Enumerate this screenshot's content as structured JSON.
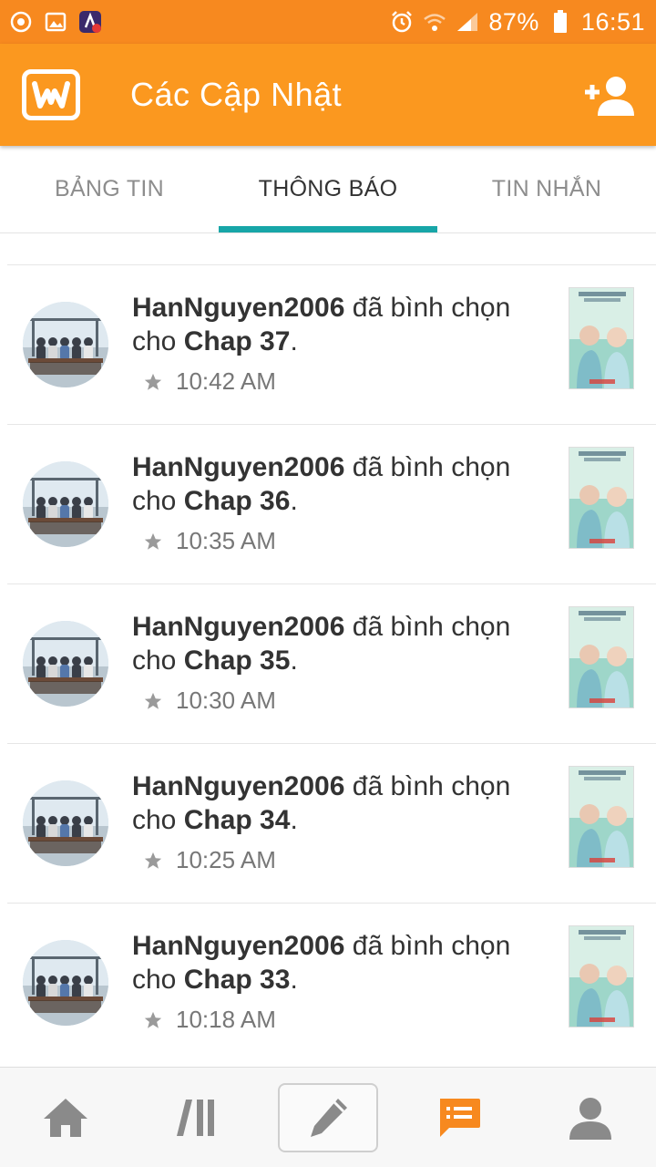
{
  "status_bar": {
    "left_icons": [
      "compass-icon",
      "image-icon",
      "app-alert-icon"
    ],
    "right_icons": [
      "alarm-icon",
      "wifi-icon",
      "signal-icon",
      "battery-icon"
    ],
    "battery": "87%",
    "time": "16:51"
  },
  "app_bar": {
    "title": "Các Cập Nhật",
    "color": "#fb981f"
  },
  "tabs": [
    {
      "label": "BẢNG TIN",
      "active": false
    },
    {
      "label": "THÔNG BÁO",
      "active": true
    },
    {
      "label": "TIN NHẮN",
      "active": false
    }
  ],
  "notifications": [
    {
      "user": "HanNguyen2006",
      "action": " đã bình chọn",
      "prefix": "cho ",
      "chapter": "Chap 37",
      "suffix": ".",
      "time": "10:42 AM"
    },
    {
      "user": "HanNguyen2006",
      "action": " đã bình chọn",
      "prefix": "cho ",
      "chapter": "Chap 36",
      "suffix": ".",
      "time": "10:35 AM"
    },
    {
      "user": "HanNguyen2006",
      "action": " đã bình chọn",
      "prefix": "cho ",
      "chapter": "Chap 35",
      "suffix": ".",
      "time": "10:30 AM"
    },
    {
      "user": "HanNguyen2006",
      "action": " đã bình chọn",
      "prefix": "cho ",
      "chapter": "Chap 34",
      "suffix": ".",
      "time": "10:25 AM"
    },
    {
      "user": "HanNguyen2006",
      "action": " đã bình chọn",
      "prefix": "cho ",
      "chapter": "Chap 33",
      "suffix": ".",
      "time": "10:18 AM"
    }
  ],
  "bottom_nav": [
    {
      "icon": "home-icon",
      "active": false
    },
    {
      "icon": "library-icon",
      "active": false
    },
    {
      "icon": "pencil-icon",
      "active": false
    },
    {
      "icon": "messages-icon",
      "active": true
    },
    {
      "icon": "profile-icon",
      "active": false
    }
  ],
  "colors": {
    "accent": "#fb981f",
    "tab_indicator": "#17a6a8",
    "active_nav": "#f7891f",
    "inactive_nav": "#8a8a8a"
  }
}
